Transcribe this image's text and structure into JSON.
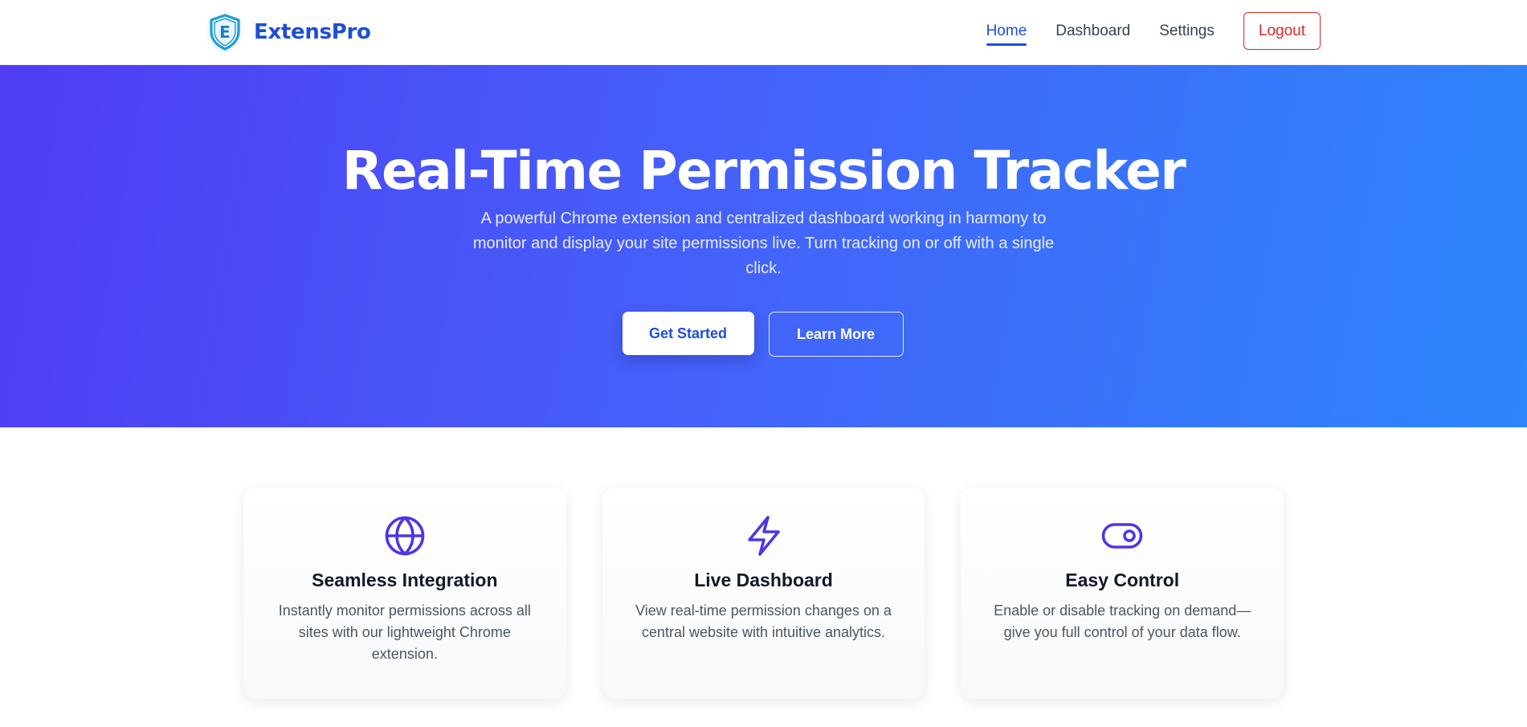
{
  "brand": {
    "name": "ExtensPro",
    "logo_letter": "E",
    "color": "#1d4ed8"
  },
  "nav": {
    "items": [
      {
        "label": "Home",
        "active": true
      },
      {
        "label": "Dashboard",
        "active": false
      },
      {
        "label": "Settings",
        "active": false
      }
    ],
    "logout_label": "Logout",
    "logout_color": "#dc2626"
  },
  "hero": {
    "title": "Real-Time Permission Tracker",
    "subtitle": "A powerful Chrome extension and centralized dashboard working in harmony to monitor and display your site permissions live. Turn tracking on or off with a single click.",
    "primary_button": "Get Started",
    "secondary_button": "Learn More",
    "gradient": [
      "#4f3cf3",
      "#2d86fb"
    ]
  },
  "features": [
    {
      "icon": "globe-icon",
      "title": "Seamless Integration",
      "description": "Instantly monitor permissions across all sites with our lightweight Chrome extension."
    },
    {
      "icon": "lightning-icon",
      "title": "Live Dashboard",
      "description": "View real-time permission changes on a central website with intuitive analytics."
    },
    {
      "icon": "toggle-icon",
      "title": "Easy Control",
      "description": "Enable or disable tracking on demand—give you full control of your data flow."
    }
  ],
  "accent_icon_color": "#4f35e6"
}
